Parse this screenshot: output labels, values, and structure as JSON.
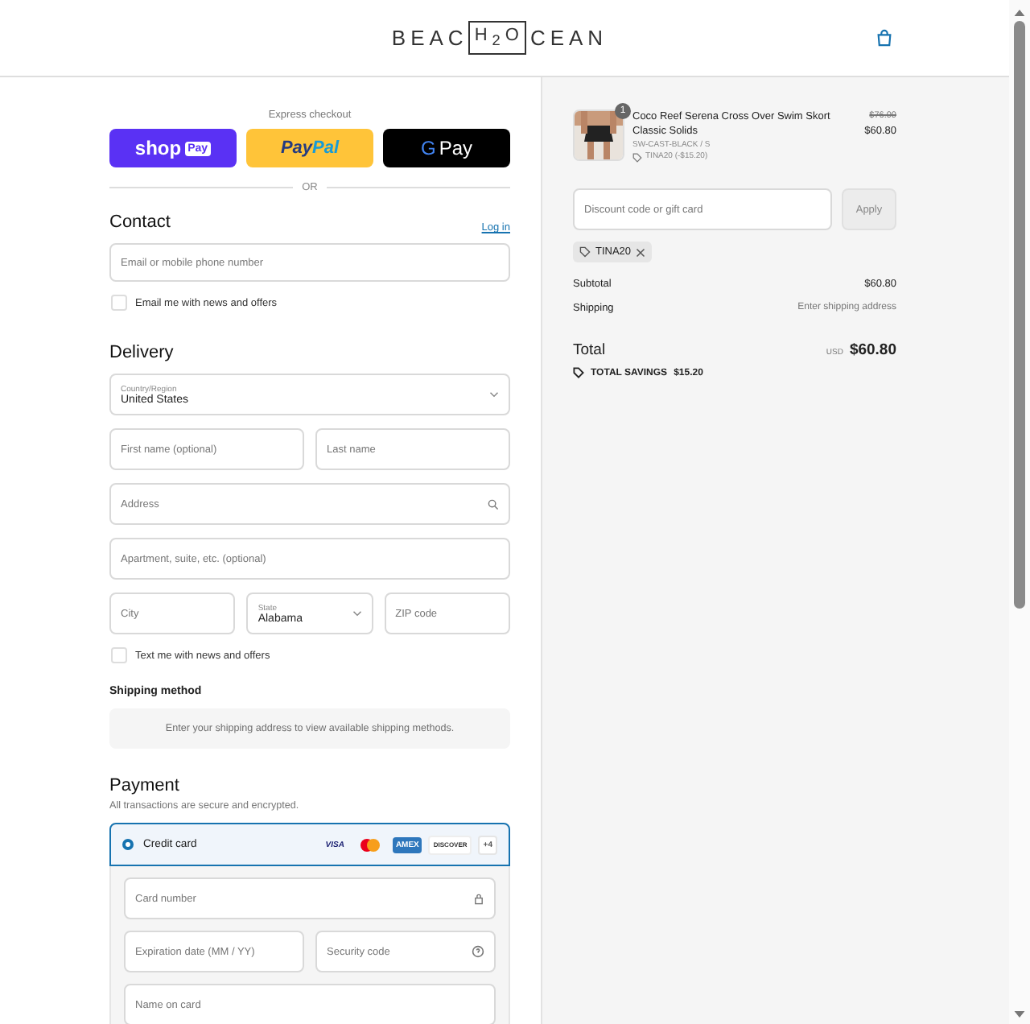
{
  "header": {
    "logo": {
      "before": "BEAC",
      "boxed": "H$_{2}$O",
      "after": "CEAN"
    }
  },
  "express": {
    "label": "Express checkout",
    "buttons": [
      {
        "kind": "shoppay",
        "label": "shop",
        "tag": "Pay"
      },
      {
        "kind": "paypal",
        "label": "Pay",
        "label2": "Pal"
      },
      {
        "kind": "gpay",
        "label": "G",
        "label2": "Pay"
      }
    ],
    "divider": "OR"
  },
  "contact": {
    "title": "Contact",
    "link": "Log in",
    "field": {
      "placeholder": "Email or mobile phone number"
    },
    "checkbox": {
      "label": "Email me with news and offers",
      "checked": false
    }
  },
  "delivery": {
    "title": "Delivery",
    "rows": [
      [
        {
          "kind": "select",
          "label": "Country/Region",
          "value": "United States"
        }
      ],
      [
        {
          "kind": "text",
          "placeholder": "First name (optional)"
        },
        {
          "kind": "text",
          "placeholder": "Last name"
        }
      ],
      [
        {
          "kind": "search",
          "placeholder": "Address"
        }
      ],
      [
        {
          "kind": "text",
          "placeholder": "Apartment, suite, etc. (optional)"
        }
      ],
      [
        {
          "kind": "text",
          "placeholder": "City"
        },
        {
          "kind": "select",
          "label": "State",
          "value": "Alabama"
        },
        {
          "kind": "text",
          "placeholder": "ZIP code"
        }
      ]
    ],
    "checkbox": {
      "label": "Text me with news and offers",
      "checked": false
    }
  },
  "shipping": {
    "title": "Shipping method",
    "note": "Enter your shipping address to view available shipping methods."
  },
  "payment": {
    "title": "Payment",
    "subtitle": "All transactions are secure and encrypted.",
    "option": {
      "label": "Credit card",
      "selected": true,
      "brands": [
        {
          "kind": "visa",
          "text": "VISA"
        },
        {
          "kind": "mastercard"
        },
        {
          "kind": "amex",
          "text": "AMEX"
        },
        {
          "kind": "discover",
          "text": "DISCOVER"
        },
        {
          "kind": "more",
          "text": "+4"
        }
      ]
    },
    "rows": [
      [
        {
          "kind": "lock",
          "placeholder": "Card number"
        }
      ],
      [
        {
          "kind": "text",
          "placeholder": "Expiration date (MM / YY)"
        },
        {
          "kind": "help",
          "placeholder": "Security code"
        }
      ],
      [
        {
          "kind": "text",
          "placeholder": "Name on card"
        }
      ]
    ]
  },
  "summary": {
    "item": {
      "quantity": "1",
      "name": "Coco Reef Serena Cross Over Swim Skort",
      "variant": "Classic Solids",
      "sku": "SW-CAST-BLACK / S",
      "discount": "TINA20 (-$15.20)",
      "old_price": "$76.00",
      "price": "$60.80"
    },
    "discount_field": {
      "placeholder": "Discount code or gift card"
    },
    "apply": "Apply",
    "code": "TINA20",
    "lines": [
      {
        "label": "Subtotal",
        "value": "$60.80",
        "kind": "amount"
      },
      {
        "label": "Shipping",
        "value": "Enter shipping address",
        "kind": "note"
      }
    ],
    "total": {
      "label": "Total",
      "currency": "USD",
      "value": "$60.80"
    },
    "savings": {
      "label": "TOTAL SAVINGS",
      "value": "$15.20"
    }
  }
}
